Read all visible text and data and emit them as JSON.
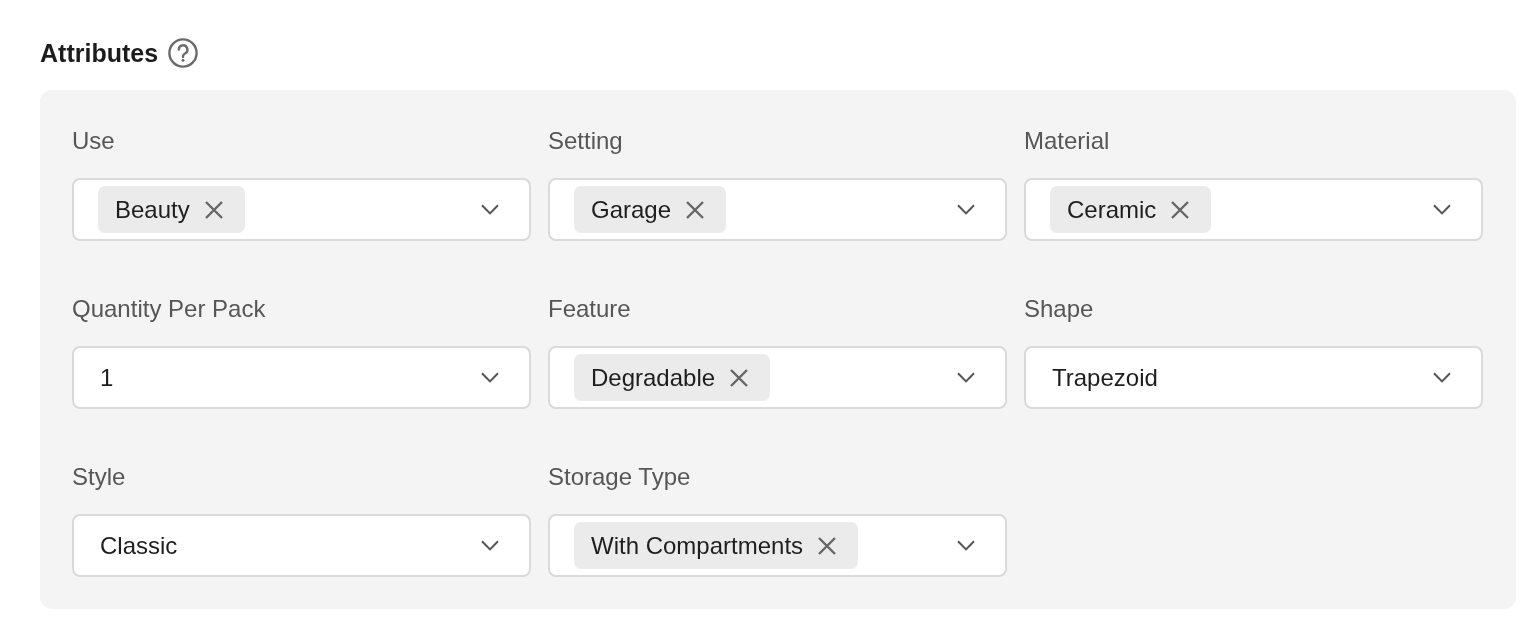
{
  "section": {
    "title": "Attributes"
  },
  "fields": [
    {
      "label": "Use",
      "kind": "tags",
      "tags": [
        "Beauty"
      ]
    },
    {
      "label": "Setting",
      "kind": "tags",
      "tags": [
        "Garage"
      ]
    },
    {
      "label": "Material",
      "kind": "tags",
      "tags": [
        "Ceramic"
      ]
    },
    {
      "label": "Quantity Per Pack",
      "kind": "text",
      "value": "1"
    },
    {
      "label": "Feature",
      "kind": "tags",
      "tags": [
        "Degradable"
      ]
    },
    {
      "label": "Shape",
      "kind": "text",
      "value": "Trapezoid"
    },
    {
      "label": "Style",
      "kind": "text",
      "value": "Classic"
    },
    {
      "label": "Storage Type",
      "kind": "tags",
      "tags": [
        "With Compartments"
      ]
    }
  ]
}
